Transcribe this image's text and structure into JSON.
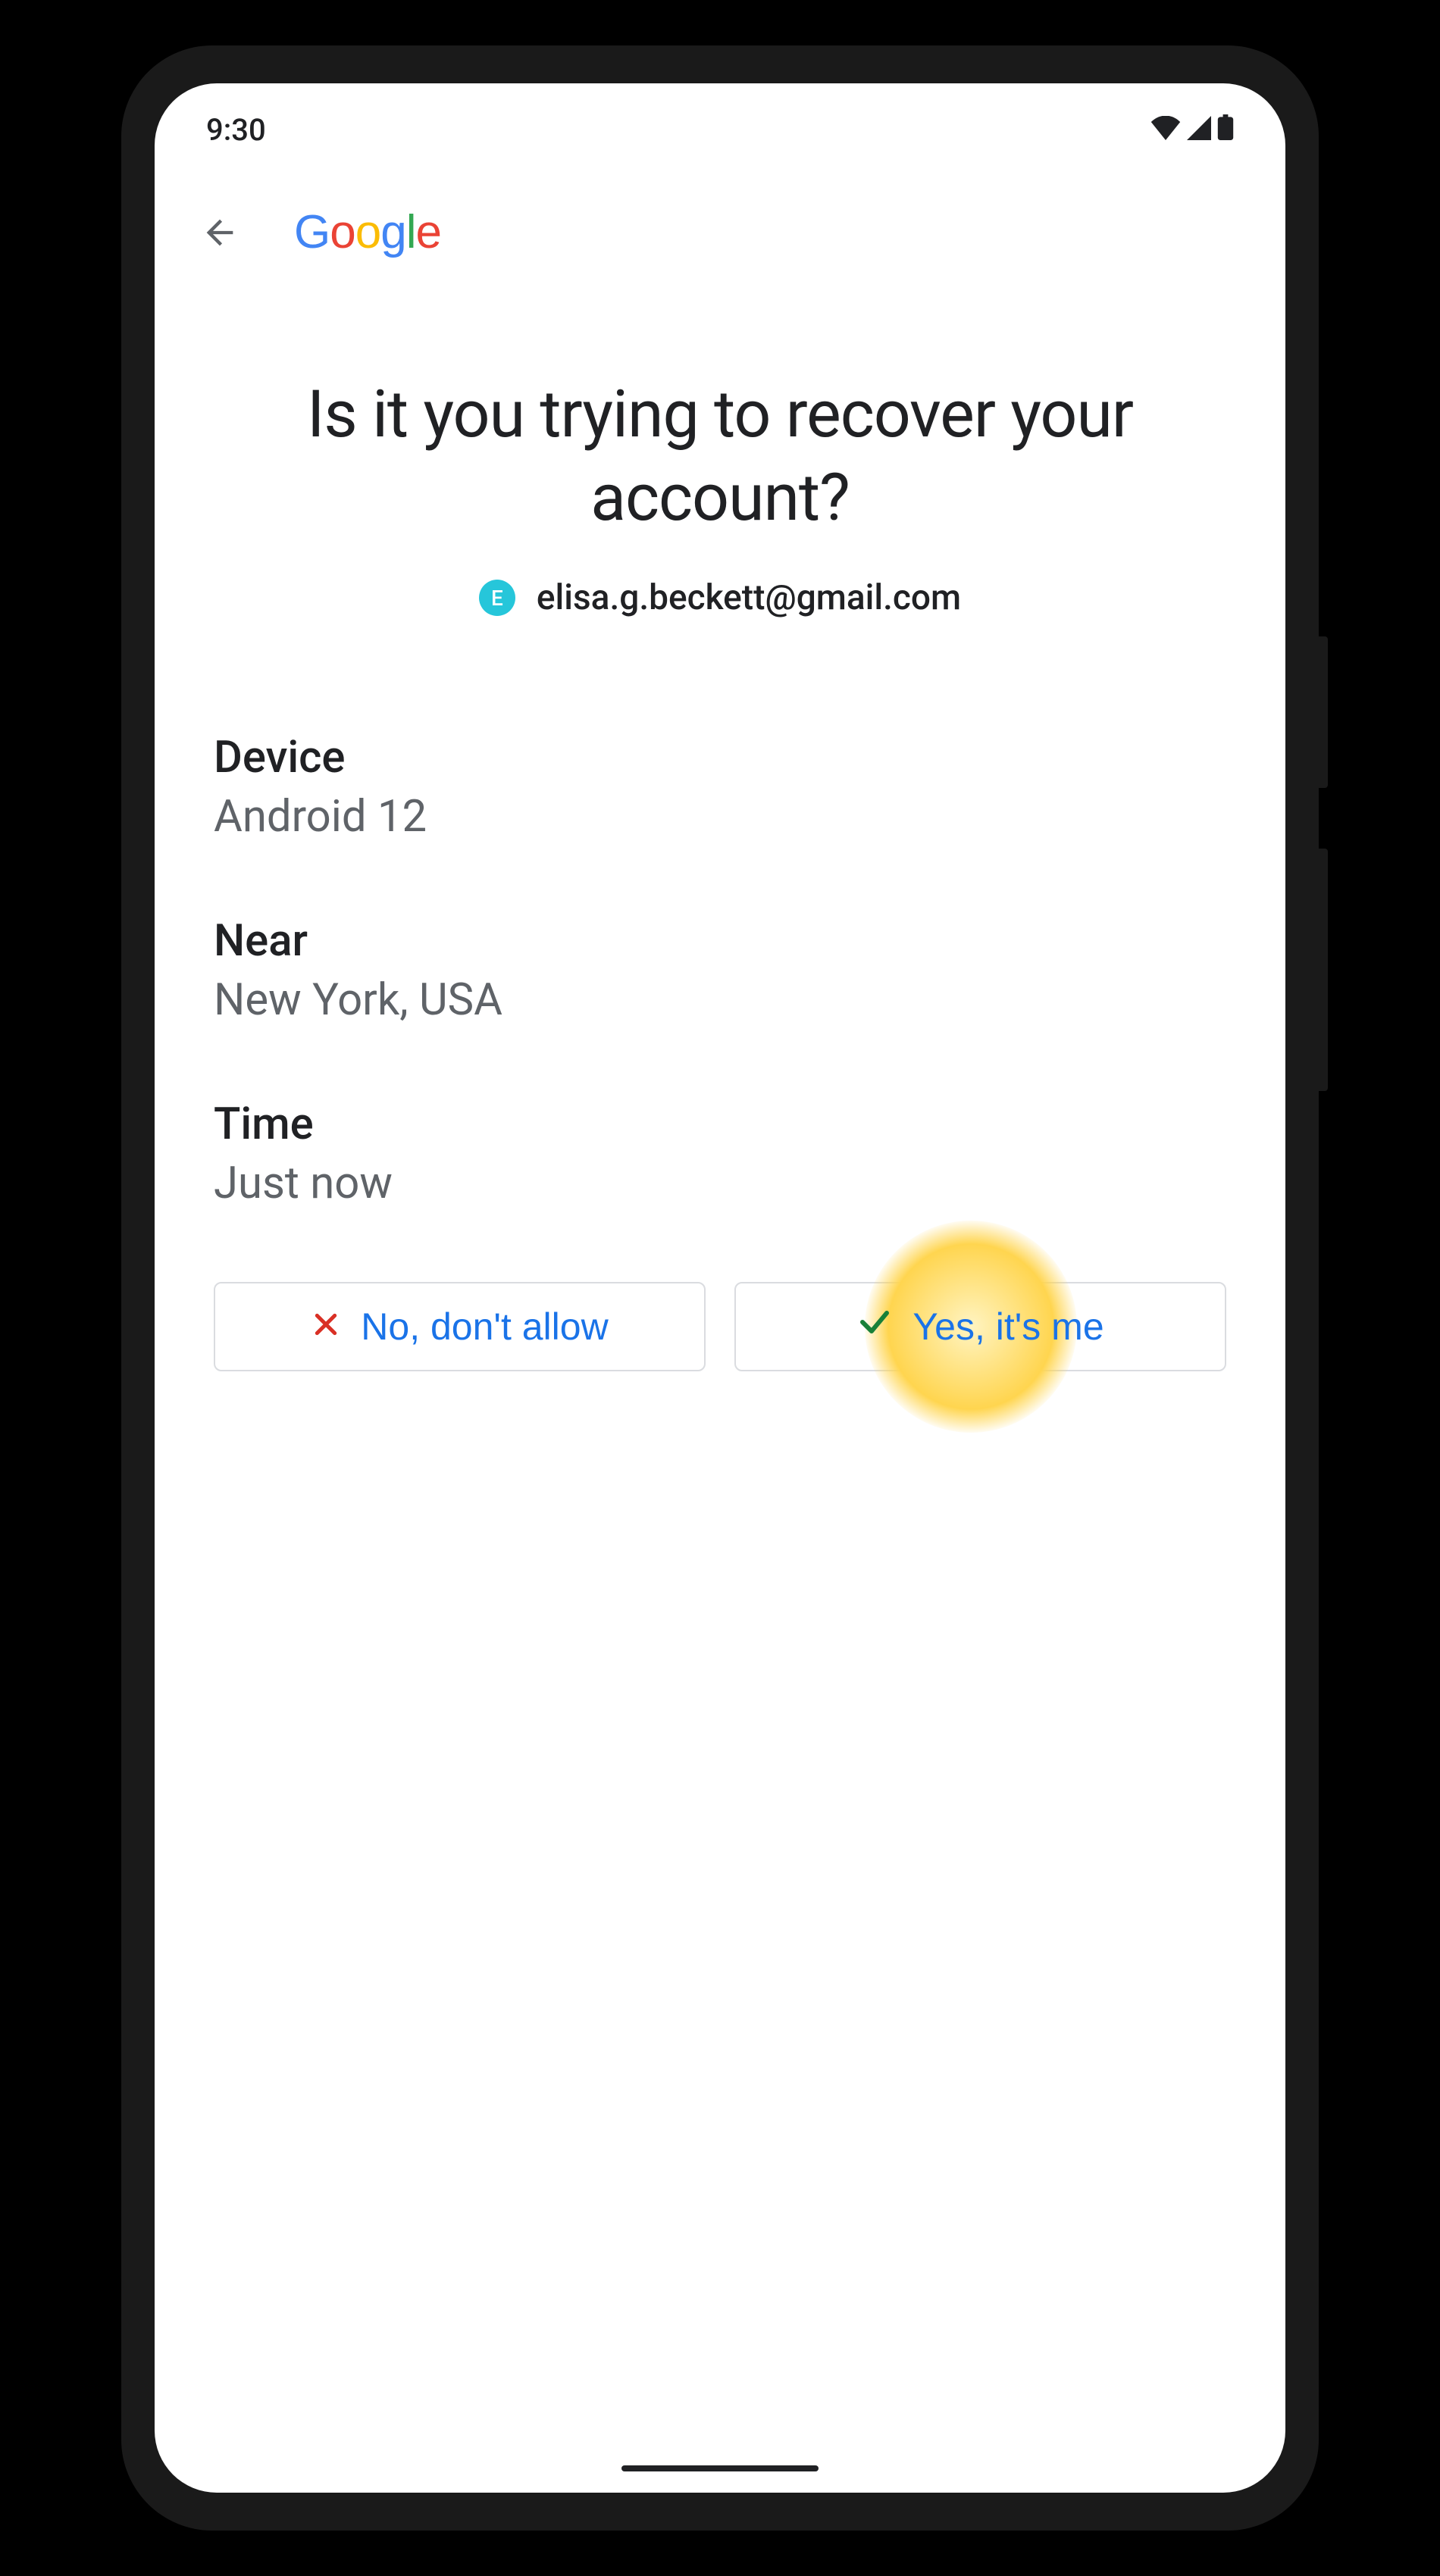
{
  "status": {
    "time": "9:30"
  },
  "header": {
    "logo_letters": [
      "G",
      "o",
      "o",
      "g",
      "l",
      "e"
    ]
  },
  "page": {
    "title": "Is it you trying to recover your account?",
    "avatar_initial": "E",
    "email": "elisa.g.beckett@gmail.com",
    "details": [
      {
        "label": "Device",
        "value": "Android 12"
      },
      {
        "label": "Near",
        "value": "New York, USA"
      },
      {
        "label": "Time",
        "value": "Just now"
      }
    ],
    "actions": {
      "deny": "No, don't allow",
      "allow": "Yes, it's me"
    }
  },
  "colors": {
    "google_blue": "#4285F4",
    "google_red": "#EA4335",
    "google_yellow": "#FBBC05",
    "google_green": "#34A853",
    "link_blue": "#1a73e8",
    "text_primary": "#202124",
    "text_secondary": "#5f6368",
    "avatar_bg": "#26c6da",
    "highlight": "#ffd54f"
  }
}
